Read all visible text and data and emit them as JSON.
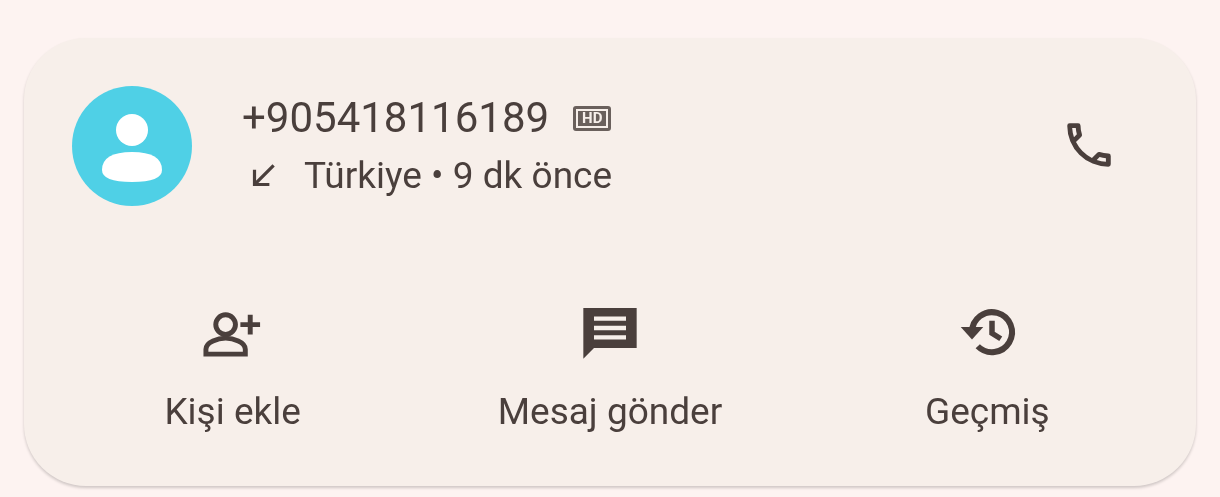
{
  "contact": {
    "number": "+905418116189",
    "hd_badge": "HD",
    "incoming": true,
    "details": "Türkiye • 9 dk önce"
  },
  "actions": [
    {
      "label": "Kişi ekle",
      "kind": "add_contact"
    },
    {
      "label": "Mesaj gönder",
      "kind": "message"
    },
    {
      "label": "Geçmiş",
      "kind": "history"
    }
  ]
}
